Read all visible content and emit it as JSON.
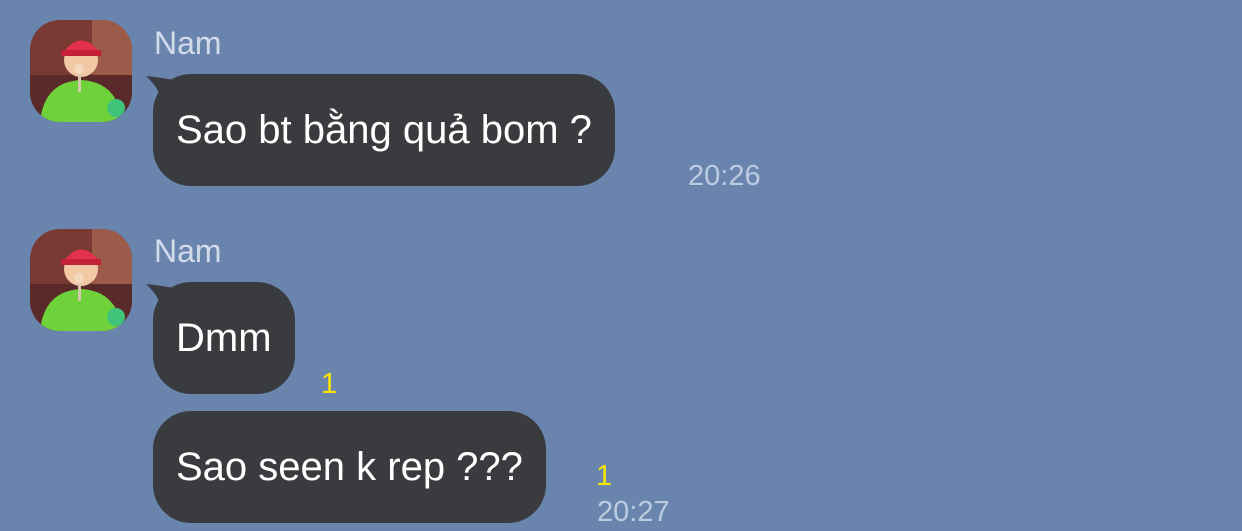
{
  "messages": [
    {
      "sender": "Nam",
      "avatar_icon": "user-avatar-icon",
      "bubbles": [
        {
          "text": "Sao bt bằng quả bom ?",
          "time": "20:26",
          "unread": ""
        }
      ]
    },
    {
      "sender": "Nam",
      "avatar_icon": "user-avatar-icon",
      "bubbles": [
        {
          "text": "Dmm",
          "time": "",
          "unread": "1"
        },
        {
          "text": "Sao seen k rep ???",
          "time": "20:27",
          "unread": "1"
        }
      ]
    }
  ],
  "colors": {
    "background": "#6985ae",
    "bubble": "#3a3b3f",
    "bubble_text": "#ffffff",
    "sender_name": "#d3dcea",
    "timestamp": "#bccbe0",
    "unread_count": "#f7e600"
  }
}
